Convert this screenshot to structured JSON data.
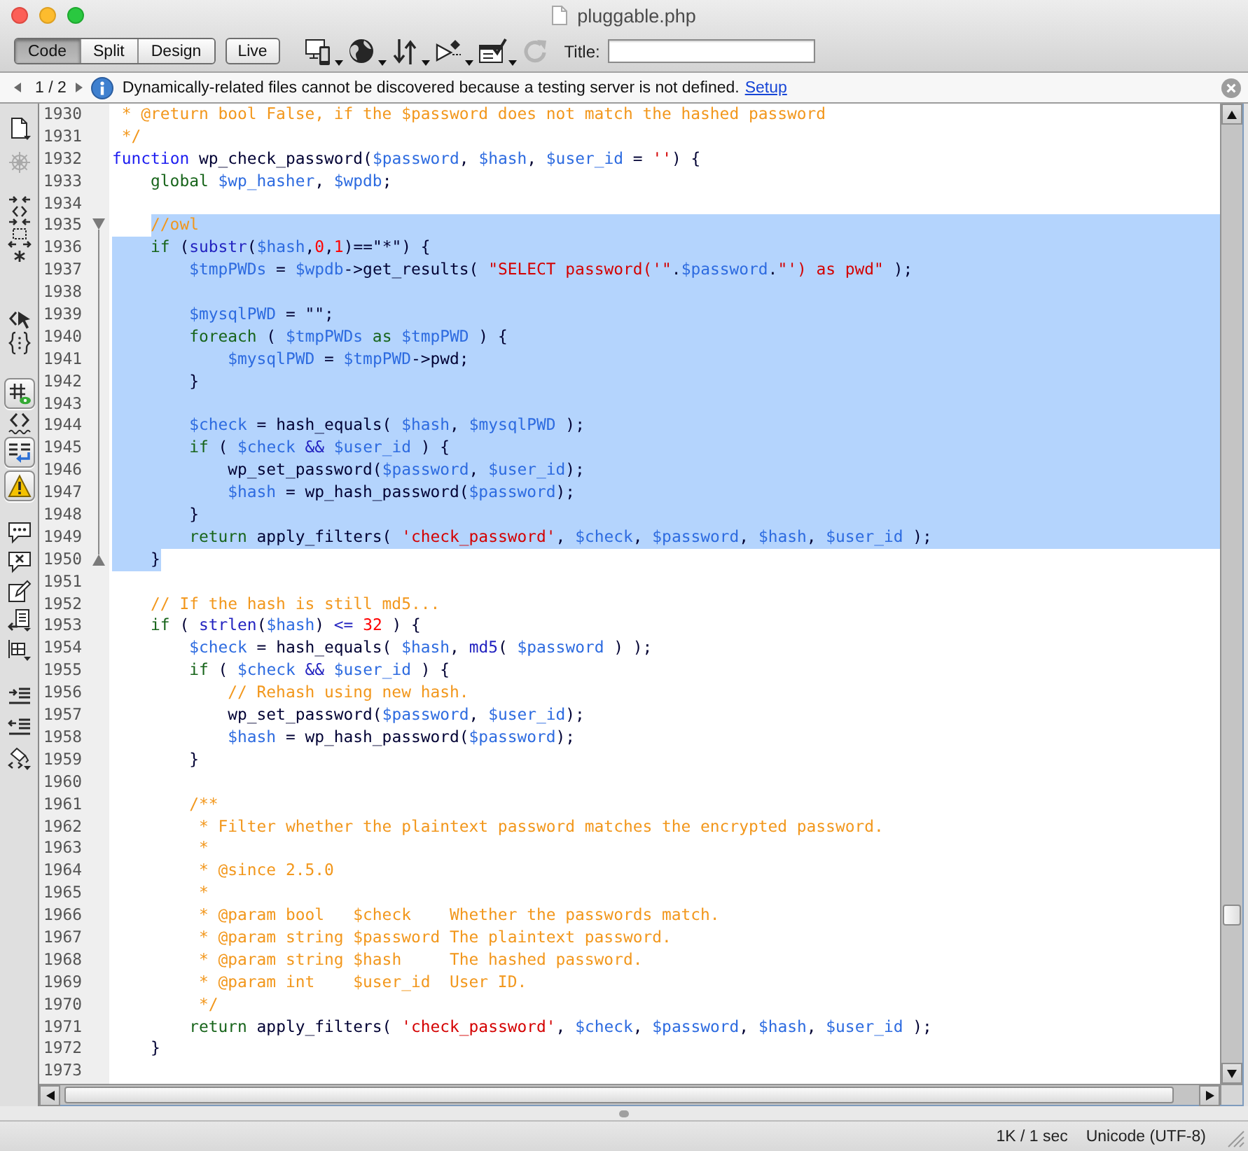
{
  "window": {
    "title": "pluggable.php"
  },
  "toolbar": {
    "views": [
      {
        "label": "Code",
        "selected": true
      },
      {
        "label": "Split",
        "selected": false
      },
      {
        "label": "Design",
        "selected": false
      }
    ],
    "live": {
      "label": "Live",
      "selected": false
    },
    "tools": [
      {
        "disabled": false
      },
      {
        "disabled": false
      },
      {
        "disabled": false
      },
      {
        "disabled": false
      },
      {
        "disabled": false
      },
      {
        "disabled": true
      }
    ],
    "title_field": {
      "label": "Title:"
    }
  },
  "info_bar": {
    "page": "1 / 2",
    "message": "Dynamically-related files cannot be discovered because a testing server is not defined.",
    "link": "Setup"
  },
  "side_toolbar": {
    "groups": [
      [
        {
          "on": false,
          "disabled": false
        },
        {
          "on": false,
          "disabled": true
        }
      ],
      [
        {
          "on": false,
          "disabled": false
        },
        {
          "on": false,
          "disabled": false
        },
        {
          "on": false,
          "disabled": false
        }
      ],
      [
        {
          "on": false,
          "disabled": false
        },
        {
          "on": false,
          "disabled": false
        }
      ],
      [
        {
          "on": true,
          "disabled": false
        },
        {
          "on": false,
          "disabled": false
        },
        {
          "on": true,
          "disabled": false
        },
        {
          "on": true,
          "disabled": false
        }
      ],
      [
        {
          "on": false,
          "disabled": false
        },
        {
          "on": false,
          "disabled": false
        },
        {
          "on": false,
          "disabled": false
        },
        {
          "on": false,
          "disabled": false
        },
        {
          "on": false,
          "disabled": false
        }
      ],
      [
        {
          "on": false,
          "disabled": false
        },
        {
          "on": false,
          "disabled": false
        },
        {
          "on": false,
          "disabled": false
        }
      ]
    ]
  },
  "editor": {
    "lines": [
      {
        "number": "1930",
        "selected": false,
        "fold_marker": false,
        "tokens": [
          {
            "kind": "comment",
            "text": " * @return bool False, if the $password does not match the hashed password"
          }
        ]
      },
      {
        "number": "1931",
        "selected": false,
        "fold_marker": false,
        "tokens": [
          {
            "kind": "comment",
            "text": " */"
          }
        ]
      },
      {
        "number": "1932",
        "selected": false,
        "fold_marker": false,
        "tokens": [
          {
            "kind": "declaration",
            "text": "function"
          },
          {
            "kind": "plain",
            "text": " wp_check_password("
          },
          {
            "kind": "variable",
            "text": "$password"
          },
          {
            "kind": "plain",
            "text": ", "
          },
          {
            "kind": "variable",
            "text": "$hash"
          },
          {
            "kind": "plain",
            "text": ", "
          },
          {
            "kind": "variable",
            "text": "$user_id"
          },
          {
            "kind": "plain",
            "text": " = "
          },
          {
            "kind": "string",
            "text": "''"
          },
          {
            "kind": "plain",
            "text": ") {"
          }
        ]
      },
      {
        "number": "1933",
        "selected": false,
        "fold_marker": false,
        "tokens": [
          {
            "kind": "keyword",
            "text": "    global "
          },
          {
            "kind": "variable",
            "text": "$wp_hasher"
          },
          {
            "kind": "plain",
            "text": ", "
          },
          {
            "kind": "variable",
            "text": "$wpdb"
          },
          {
            "kind": "plain",
            "text": ";"
          }
        ]
      },
      {
        "number": "1934",
        "selected": false,
        "fold_marker": false
      },
      {
        "number": "1935",
        "selected": true,
        "fold_marker": true,
        "tokens": [
          {
            "kind": "comment",
            "text": "    //owl"
          }
        ]
      },
      {
        "number": "1936",
        "selected": true,
        "fold_marker": false,
        "tokens": [
          {
            "kind": "keyword",
            "text": "    if"
          },
          {
            "kind": "plain",
            "text": " ("
          },
          {
            "kind": "builtin",
            "text": "substr"
          },
          {
            "kind": "plain",
            "text": "("
          },
          {
            "kind": "variable",
            "text": "$hash"
          },
          {
            "kind": "plain",
            "text": ","
          },
          {
            "kind": "number",
            "text": "0"
          },
          {
            "kind": "plain",
            "text": ","
          },
          {
            "kind": "number",
            "text": "1"
          },
          {
            "kind": "plain",
            "text": ")==\"*\") {"
          }
        ]
      },
      {
        "number": "1937",
        "selected": true,
        "fold_marker": false,
        "tokens": [
          {
            "kind": "variable",
            "text": "        $tmpPWDs"
          },
          {
            "kind": "plain",
            "text": " = "
          },
          {
            "kind": "variable",
            "text": "$wpdb"
          },
          {
            "kind": "plain",
            "text": "->get_results( "
          },
          {
            "kind": "string",
            "text": "\"SELECT password('\""
          },
          {
            "kind": "plain",
            "text": "."
          },
          {
            "kind": "variable",
            "text": "$password"
          },
          {
            "kind": "plain",
            "text": "."
          },
          {
            "kind": "string",
            "text": "\"') as pwd\""
          },
          {
            "kind": "plain",
            "text": " );"
          }
        ]
      },
      {
        "number": "1938",
        "selected": true,
        "fold_marker": false
      },
      {
        "number": "1939",
        "selected": true,
        "fold_marker": false,
        "tokens": [
          {
            "kind": "variable",
            "text": "        $mysqlPWD"
          },
          {
            "kind": "plain",
            "text": " = \"\";"
          }
        ]
      },
      {
        "number": "1940",
        "selected": true,
        "fold_marker": false,
        "tokens": [
          {
            "kind": "keyword",
            "text": "        foreach"
          },
          {
            "kind": "plain",
            "text": " ( "
          },
          {
            "kind": "variable",
            "text": "$tmpPWDs"
          },
          {
            "kind": "keyword",
            "text": " as "
          },
          {
            "kind": "variable",
            "text": "$tmpPWD"
          },
          {
            "kind": "plain",
            "text": " ) {"
          }
        ]
      },
      {
        "number": "1941",
        "selected": true,
        "fold_marker": false,
        "tokens": [
          {
            "kind": "variable",
            "text": "            $mysqlPWD"
          },
          {
            "kind": "plain",
            "text": " = "
          },
          {
            "kind": "variable",
            "text": "$tmpPWD"
          },
          {
            "kind": "plain",
            "text": "->pwd;"
          }
        ]
      },
      {
        "number": "1942",
        "selected": true,
        "fold_marker": false,
        "tokens": [
          {
            "kind": "plain",
            "text": "        }"
          }
        ]
      },
      {
        "number": "1943",
        "selected": true,
        "fold_marker": false
      },
      {
        "number": "1944",
        "selected": true,
        "fold_marker": false,
        "tokens": [
          {
            "kind": "variable",
            "text": "        $check"
          },
          {
            "kind": "plain",
            "text": " = hash_equals( "
          },
          {
            "kind": "variable",
            "text": "$hash"
          },
          {
            "kind": "plain",
            "text": ", "
          },
          {
            "kind": "variable",
            "text": "$mysqlPWD"
          },
          {
            "kind": "plain",
            "text": " );"
          }
        ]
      },
      {
        "number": "1945",
        "selected": true,
        "fold_marker": false,
        "tokens": [
          {
            "kind": "keyword",
            "text": "        if"
          },
          {
            "kind": "plain",
            "text": " ( "
          },
          {
            "kind": "variable",
            "text": "$check"
          },
          {
            "kind": "operator",
            "text": " && "
          },
          {
            "kind": "variable",
            "text": "$user_id"
          },
          {
            "kind": "plain",
            "text": " ) {"
          }
        ]
      },
      {
        "number": "1946",
        "selected": true,
        "fold_marker": false,
        "tokens": [
          {
            "kind": "plain",
            "text": "            wp_set_password("
          },
          {
            "kind": "variable",
            "text": "$password"
          },
          {
            "kind": "plain",
            "text": ", "
          },
          {
            "kind": "variable",
            "text": "$user_id"
          },
          {
            "kind": "plain",
            "text": ");"
          }
        ]
      },
      {
        "number": "1947",
        "selected": true,
        "fold_marker": false,
        "tokens": [
          {
            "kind": "variable",
            "text": "            $hash"
          },
          {
            "kind": "plain",
            "text": " = wp_hash_password("
          },
          {
            "kind": "variable",
            "text": "$password"
          },
          {
            "kind": "plain",
            "text": ");"
          }
        ]
      },
      {
        "number": "1948",
        "selected": true,
        "fold_marker": false,
        "tokens": [
          {
            "kind": "plain",
            "text": "        }"
          }
        ]
      },
      {
        "number": "1949",
        "selected": true,
        "fold_marker": false,
        "tokens": [
          {
            "kind": "keyword",
            "text": "        return"
          },
          {
            "kind": "plain",
            "text": " apply_filters( "
          },
          {
            "kind": "string",
            "text": "'check_password'"
          },
          {
            "kind": "plain",
            "text": ", "
          },
          {
            "kind": "variable",
            "text": "$check"
          },
          {
            "kind": "plain",
            "text": ", "
          },
          {
            "kind": "variable",
            "text": "$password"
          },
          {
            "kind": "plain",
            "text": ", "
          },
          {
            "kind": "variable",
            "text": "$hash"
          },
          {
            "kind": "plain",
            "text": ", "
          },
          {
            "kind": "variable",
            "text": "$user_id"
          },
          {
            "kind": "plain",
            "text": " );"
          }
        ]
      },
      {
        "number": "1950",
        "selected": true,
        "fold_marker": true,
        "tokens": [
          {
            "kind": "plain",
            "text": "    }"
          }
        ]
      },
      {
        "number": "1951",
        "selected": false,
        "fold_marker": false
      },
      {
        "number": "1952",
        "selected": false,
        "fold_marker": false,
        "tokens": [
          {
            "kind": "comment",
            "text": "    // If the hash is still md5..."
          }
        ]
      },
      {
        "number": "1953",
        "selected": false,
        "fold_marker": false,
        "tokens": [
          {
            "kind": "keyword",
            "text": "    if"
          },
          {
            "kind": "plain",
            "text": " ( "
          },
          {
            "kind": "builtin",
            "text": "strlen"
          },
          {
            "kind": "plain",
            "text": "("
          },
          {
            "kind": "variable",
            "text": "$hash"
          },
          {
            "kind": "plain",
            "text": ")"
          },
          {
            "kind": "operator",
            "text": " <= "
          },
          {
            "kind": "number",
            "text": "32"
          },
          {
            "kind": "plain",
            "text": " ) {"
          }
        ]
      },
      {
        "number": "1954",
        "selected": false,
        "fold_marker": false,
        "tokens": [
          {
            "kind": "variable",
            "text": "        $check"
          },
          {
            "kind": "plain",
            "text": " = hash_equals( "
          },
          {
            "kind": "variable",
            "text": "$hash"
          },
          {
            "kind": "plain",
            "text": ", "
          },
          {
            "kind": "builtin",
            "text": "md5"
          },
          {
            "kind": "plain",
            "text": "( "
          },
          {
            "kind": "variable",
            "text": "$password"
          },
          {
            "kind": "plain",
            "text": " ) );"
          }
        ]
      },
      {
        "number": "1955",
        "selected": false,
        "fold_marker": false,
        "tokens": [
          {
            "kind": "keyword",
            "text": "        if"
          },
          {
            "kind": "plain",
            "text": " ( "
          },
          {
            "kind": "variable",
            "text": "$check"
          },
          {
            "kind": "operator",
            "text": " && "
          },
          {
            "kind": "variable",
            "text": "$user_id"
          },
          {
            "kind": "plain",
            "text": " ) {"
          }
        ]
      },
      {
        "number": "1956",
        "selected": false,
        "fold_marker": false,
        "tokens": [
          {
            "kind": "comment",
            "text": "            // Rehash using new hash."
          }
        ]
      },
      {
        "number": "1957",
        "selected": false,
        "fold_marker": false,
        "tokens": [
          {
            "kind": "plain",
            "text": "            wp_set_password("
          },
          {
            "kind": "variable",
            "text": "$password"
          },
          {
            "kind": "plain",
            "text": ", "
          },
          {
            "kind": "variable",
            "text": "$user_id"
          },
          {
            "kind": "plain",
            "text": ");"
          }
        ]
      },
      {
        "number": "1958",
        "selected": false,
        "fold_marker": false,
        "tokens": [
          {
            "kind": "variable",
            "text": "            $hash"
          },
          {
            "kind": "plain",
            "text": " = wp_hash_password("
          },
          {
            "kind": "variable",
            "text": "$password"
          },
          {
            "kind": "plain",
            "text": ");"
          }
        ]
      },
      {
        "number": "1959",
        "selected": false,
        "fold_marker": false,
        "tokens": [
          {
            "kind": "plain",
            "text": "        }"
          }
        ]
      },
      {
        "number": "1960",
        "selected": false,
        "fold_marker": false
      },
      {
        "number": "1961",
        "selected": false,
        "fold_marker": false,
        "tokens": [
          {
            "kind": "comment",
            "text": "        /**"
          }
        ]
      },
      {
        "number": "1962",
        "selected": false,
        "fold_marker": false,
        "tokens": [
          {
            "kind": "comment",
            "text": "         * Filter whether the plaintext password matches the encrypted password."
          }
        ]
      },
      {
        "number": "1963",
        "selected": false,
        "fold_marker": false,
        "tokens": [
          {
            "kind": "comment",
            "text": "         *"
          }
        ]
      },
      {
        "number": "1964",
        "selected": false,
        "fold_marker": false,
        "tokens": [
          {
            "kind": "comment",
            "text": "         * @since 2.5.0"
          }
        ]
      },
      {
        "number": "1965",
        "selected": false,
        "fold_marker": false,
        "tokens": [
          {
            "kind": "comment",
            "text": "         *"
          }
        ]
      },
      {
        "number": "1966",
        "selected": false,
        "fold_marker": false,
        "tokens": [
          {
            "kind": "comment",
            "text": "         * @param bool   $check    Whether the passwords match."
          }
        ]
      },
      {
        "number": "1967",
        "selected": false,
        "fold_marker": false,
        "tokens": [
          {
            "kind": "comment",
            "text": "         * @param string $password The plaintext password."
          }
        ]
      },
      {
        "number": "1968",
        "selected": false,
        "fold_marker": false,
        "tokens": [
          {
            "kind": "comment",
            "text": "         * @param string $hash     The hashed password."
          }
        ]
      },
      {
        "number": "1969",
        "selected": false,
        "fold_marker": false,
        "tokens": [
          {
            "kind": "comment",
            "text": "         * @param int    $user_id  User ID."
          }
        ]
      },
      {
        "number": "1970",
        "selected": false,
        "fold_marker": false,
        "tokens": [
          {
            "kind": "comment",
            "text": "         */"
          }
        ]
      },
      {
        "number": "1971",
        "selected": false,
        "fold_marker": false,
        "tokens": [
          {
            "kind": "keyword",
            "text": "        return"
          },
          {
            "kind": "plain",
            "text": " apply_filters( "
          },
          {
            "kind": "string",
            "text": "'check_password'"
          },
          {
            "kind": "plain",
            "text": ", "
          },
          {
            "kind": "variable",
            "text": "$check"
          },
          {
            "kind": "plain",
            "text": ", "
          },
          {
            "kind": "variable",
            "text": "$password"
          },
          {
            "kind": "plain",
            "text": ", "
          },
          {
            "kind": "variable",
            "text": "$hash"
          },
          {
            "kind": "plain",
            "text": ", "
          },
          {
            "kind": "variable",
            "text": "$user_id"
          },
          {
            "kind": "plain",
            "text": " );"
          }
        ]
      },
      {
        "number": "1972",
        "selected": false,
        "fold_marker": false,
        "tokens": [
          {
            "kind": "plain",
            "text": "    }"
          }
        ]
      },
      {
        "number": "1973",
        "selected": false,
        "fold_marker": false
      }
    ]
  },
  "status_bar": {
    "items": [
      "1K / 1 sec",
      "Unicode (UTF-8)"
    ]
  }
}
